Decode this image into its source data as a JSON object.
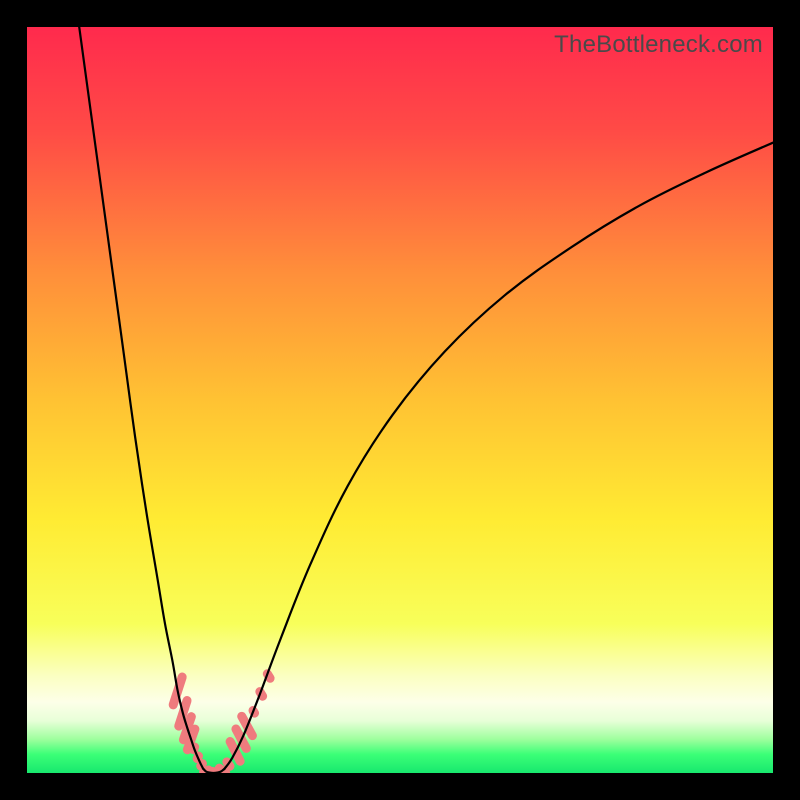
{
  "watermark": "TheBottleneck.com",
  "chart_data": {
    "type": "line",
    "title": "",
    "xlabel": "",
    "ylabel": "",
    "xlim": [
      0,
      100
    ],
    "ylim": [
      0,
      100
    ],
    "gradient_stops": [
      {
        "offset": 0,
        "color": "#ff2a4d"
      },
      {
        "offset": 0.14,
        "color": "#ff4b46"
      },
      {
        "offset": 0.33,
        "color": "#ff8f3a"
      },
      {
        "offset": 0.5,
        "color": "#ffc233"
      },
      {
        "offset": 0.66,
        "color": "#ffeb33"
      },
      {
        "offset": 0.8,
        "color": "#f8ff5a"
      },
      {
        "offset": 0.87,
        "color": "#fbffc2"
      },
      {
        "offset": 0.905,
        "color": "#fdffe8"
      },
      {
        "offset": 0.93,
        "color": "#e8ffd8"
      },
      {
        "offset": 0.955,
        "color": "#9dff9d"
      },
      {
        "offset": 0.975,
        "color": "#3bff77"
      },
      {
        "offset": 1.0,
        "color": "#18e86e"
      }
    ],
    "series": [
      {
        "name": "left-branch",
        "x": [
          7.0,
          8.5,
          10.0,
          11.5,
          13.0,
          14.5,
          16.0,
          17.5,
          18.5,
          19.5,
          20.2,
          20.9,
          21.5,
          22.0,
          22.4,
          22.8,
          23.2,
          23.6
        ],
        "y": [
          100,
          89,
          78,
          67,
          56,
          45,
          35,
          26,
          20,
          15,
          11,
          8,
          6,
          4.5,
          3.3,
          2.3,
          1.4,
          0.6
        ]
      },
      {
        "name": "valley-floor",
        "x": [
          23.6,
          24.0,
          24.5,
          25.0,
          25.5,
          26.0,
          26.5
        ],
        "y": [
          0.6,
          0.2,
          0.05,
          0.0,
          0.05,
          0.2,
          0.6
        ]
      },
      {
        "name": "right-branch",
        "x": [
          26.5,
          27.5,
          29.0,
          31.0,
          34.0,
          38.0,
          43.0,
          49.0,
          56.0,
          64.0,
          73.0,
          82.0,
          91.0,
          100.0
        ],
        "y": [
          0.6,
          2.0,
          5.0,
          10.0,
          18.0,
          28.0,
          38.5,
          48.0,
          56.5,
          64.0,
          70.5,
          76.0,
          80.5,
          84.5
        ]
      }
    ],
    "markers": {
      "name": "highlight-dots",
      "color": "#ef7b7e",
      "points": [
        {
          "x": 20.2,
          "y": 11.0,
          "len": 3.2,
          "angle": -72
        },
        {
          "x": 20.9,
          "y": 8.0,
          "len": 3.0,
          "angle": -72
        },
        {
          "x": 21.5,
          "y": 6.0,
          "len": 2.8,
          "angle": -71
        },
        {
          "x": 22.0,
          "y": 4.5,
          "len": 2.6,
          "angle": -70
        },
        {
          "x": 22.4,
          "y": 3.3,
          "len": 1.0,
          "angle": -68
        },
        {
          "x": 22.9,
          "y": 2.1,
          "len": 1.0,
          "angle": -64
        },
        {
          "x": 23.4,
          "y": 1.1,
          "len": 1.0,
          "angle": -55
        },
        {
          "x": 24.0,
          "y": 0.25,
          "len": 1.2,
          "angle": -25
        },
        {
          "x": 24.7,
          "y": 0.03,
          "len": 1.6,
          "angle": 0
        },
        {
          "x": 25.5,
          "y": 0.07,
          "len": 1.6,
          "angle": 12
        },
        {
          "x": 26.2,
          "y": 0.35,
          "len": 1.4,
          "angle": 35
        },
        {
          "x": 27.0,
          "y": 1.2,
          "len": 1.2,
          "angle": 55
        },
        {
          "x": 27.9,
          "y": 2.9,
          "len": 2.6,
          "angle": 63
        },
        {
          "x": 28.7,
          "y": 4.6,
          "len": 2.6,
          "angle": 62
        },
        {
          "x": 29.5,
          "y": 6.3,
          "len": 2.6,
          "angle": 61
        },
        {
          "x": 30.4,
          "y": 8.2,
          "len": 1.0,
          "angle": 60
        },
        {
          "x": 31.4,
          "y": 10.6,
          "len": 1.2,
          "angle": 59
        },
        {
          "x": 32.4,
          "y": 13.0,
          "len": 1.2,
          "angle": 58
        }
      ]
    }
  }
}
